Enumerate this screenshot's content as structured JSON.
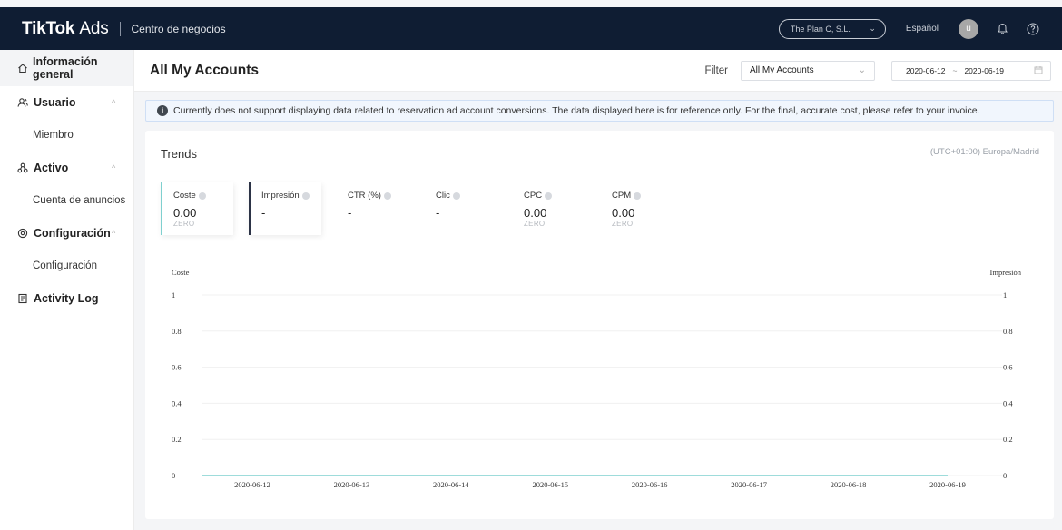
{
  "header": {
    "brand": "TikTok",
    "brand_suffix": "Ads",
    "center_label": "Centro de negocios",
    "account_selector": "The Plan C, S.L.",
    "language": "Español",
    "avatar_letter": "u"
  },
  "sidebar": {
    "items": [
      {
        "label": "Información general",
        "icon": "home-icon",
        "type": "item",
        "active": true
      },
      {
        "label": "Usuario",
        "icon": "user-icon",
        "type": "group"
      },
      {
        "label": "Miembro",
        "type": "sub"
      },
      {
        "label": "Activo",
        "icon": "assets-icon",
        "type": "group"
      },
      {
        "label": "Cuenta de anuncios",
        "type": "sub"
      },
      {
        "label": "Configuración",
        "icon": "settings-icon",
        "type": "group"
      },
      {
        "label": "Configuración",
        "type": "sub"
      },
      {
        "label": "Activity Log",
        "icon": "log-icon",
        "type": "item"
      }
    ]
  },
  "page": {
    "title": "All My Accounts",
    "filter_label": "Filter",
    "filter_value": "All My Accounts",
    "date_start": "2020-06-12",
    "date_sep": "~",
    "date_end": "2020-06-19"
  },
  "notice": "Currently does not support displaying data related to reservation ad account conversions. The data displayed here is for reference only. For the final, accurate cost, please refer to your invoice.",
  "trends": {
    "title": "Trends",
    "timezone": "(UTC+01:00) Europa/Madrid",
    "metrics": [
      {
        "name": "Coste",
        "value": "0.00",
        "sub": "ZERO"
      },
      {
        "name": "Impresión",
        "value": "-",
        "sub": ""
      },
      {
        "name": "CTR (%)",
        "value": "-",
        "sub": ""
      },
      {
        "name": "Clic",
        "value": "-",
        "sub": ""
      },
      {
        "name": "CPC",
        "value": "0.00",
        "sub": "ZERO"
      },
      {
        "name": "CPM",
        "value": "0.00",
        "sub": "ZERO"
      }
    ]
  },
  "chart_data": {
    "type": "line",
    "ylabel_left": "Coste",
    "ylabel_right": "Impresión",
    "x": [
      "2020-06-12",
      "2020-06-13",
      "2020-06-14",
      "2020-06-15",
      "2020-06-16",
      "2020-06-17",
      "2020-06-18",
      "2020-06-19"
    ],
    "y_ticks": [
      "0",
      "0.2",
      "0.4",
      "0.6",
      "0.8",
      "1"
    ],
    "ylim": [
      0,
      1
    ],
    "series": [
      {
        "name": "Coste",
        "values": [
          0,
          0,
          0,
          0,
          0,
          0,
          0,
          0
        ],
        "color": "#7fd0cf"
      }
    ]
  }
}
